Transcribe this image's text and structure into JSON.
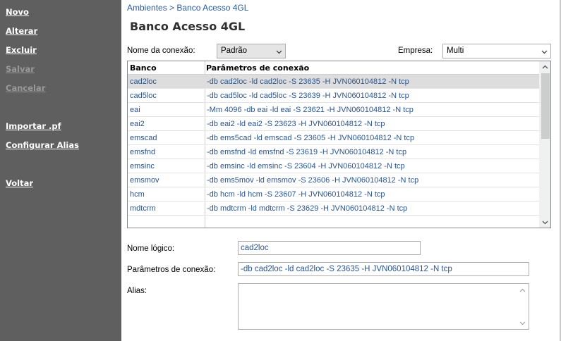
{
  "sidebar": {
    "items": [
      {
        "label": "Novo",
        "enabled": true
      },
      {
        "label": "Alterar",
        "enabled": true
      },
      {
        "label": "Excluir",
        "enabled": true
      },
      {
        "label": "Salvar",
        "enabled": false
      },
      {
        "label": "Cancelar",
        "enabled": false
      },
      {
        "label": "Importar .pf",
        "enabled": true
      },
      {
        "label": "Configurar Alias",
        "enabled": true
      },
      {
        "label": "Voltar",
        "enabled": true
      }
    ]
  },
  "breadcrumb": "Ambientes > Banco Acesso 4GL",
  "page_title": "Banco Acesso 4GL",
  "connection": {
    "label": "Nome da conexão:",
    "value": "Padrão"
  },
  "company": {
    "label": "Empresa:",
    "value": "Multi"
  },
  "grid": {
    "headers": [
      "Banco",
      "Parâmetros de conexão"
    ],
    "rows": [
      {
        "banco": "cad2loc",
        "params": "-db cad2loc -ld cad2loc -S 23635 -H JVN060104812 -N tcp"
      },
      {
        "banco": "cad5loc",
        "params": "-db cad5loc -ld cad5loc -S 23639 -H JVN060104812 -N tcp"
      },
      {
        "banco": "eai",
        "params": "-Mm 4096 -db eai -ld eai -S 23621 -H JVN060104812 -N tcp"
      },
      {
        "banco": "eai2",
        "params": "-db eai2 -ld eai2 -S 23623 -H JVN060104812 -N tcp"
      },
      {
        "banco": "emscad",
        "params": "-db ems5cad -ld emscad -S 23605 -H JVN060104812 -N tcp"
      },
      {
        "banco": "emsfnd",
        "params": "-db emsfnd -ld emsfnd -S 23619 -H JVN060104812 -N tcp"
      },
      {
        "banco": "emsinc",
        "params": "-db emsinc -ld emsinc -S 23604 -H JVN060104812 -N tcp"
      },
      {
        "banco": "emsmov",
        "params": "-db ems5mov -ld emsmov -S 23606 -H JVN060104812 -N tcp"
      },
      {
        "banco": "hcm",
        "params": "-db hcm -ld hcm -S 23607 -H JVN060104812 -N tcp"
      },
      {
        "banco": "mdtcrm",
        "params": "-db mdtcrm -ld mdtcrm -S 23629 -H JVN060104812 -N tcp"
      }
    ],
    "selected_row": 0
  },
  "logical_name": {
    "label": "Nome lógico:",
    "value": "cad2loc"
  },
  "conn_params": {
    "label": "Parâmetros de conexão:",
    "value": "-db cad2loc -ld cad2loc -S 23635 -H JVN060104812 -N tcp"
  },
  "alias": {
    "label": "Alias:",
    "value": ""
  },
  "colors": {
    "sidebar_bg": "#5f5f5f",
    "link": "#2a5591",
    "selected_row": "#dddddd"
  },
  "icons": [
    "chevron-down-icon",
    "scroll-up-icon",
    "scroll-down-icon"
  ]
}
